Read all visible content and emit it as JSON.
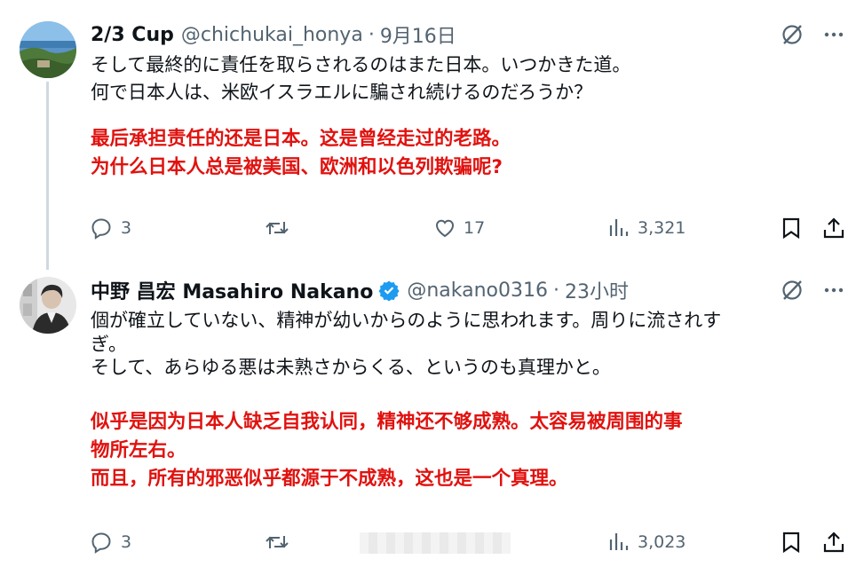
{
  "tweets": [
    {
      "name": "2/3 Cup",
      "handle": "@chichukai_honya",
      "separator": "·",
      "time": "9月16日",
      "verified": false,
      "text_lines": [
        "そして最終的に責任を取らされるのはまた日本。いつかきた道。",
        "何で日本人は、米欧イスラエルに騙され続けるのだろうか？"
      ],
      "translation_lines": [
        "最后承担责任的还是日本。这是曾经走过的老路。",
        "为什么日本人总是被美国、欧洲和以色列欺骗呢?"
      ],
      "replies": "3",
      "retweets": "",
      "likes": "17",
      "views": "3,321"
    },
    {
      "name": "中野 昌宏 Masahiro Nakano",
      "handle": "@nakano0316",
      "separator": "·",
      "time": "23小时",
      "verified": true,
      "text_lines": [
        "個が確立していない、精神が幼いからのように思われます。周りに流されす",
        "ぎ。",
        "そして、あらゆる悪は未熟さからくる、というのも真理かと。"
      ],
      "translation_lines": [
        "似乎是因为日本人缺乏自我认同，精神还不够成熟。太容易被周围的事",
        "物所左右。",
        "而且，所有的邪恶似乎都源于不成熟，这也是一个真理。"
      ],
      "replies": "3",
      "retweets": "",
      "likes": "",
      "views": "3,023"
    }
  ],
  "colors": {
    "text": "#0f1419",
    "secondary": "#536471",
    "translation": "#e0120f",
    "verified": "#1d9bf0",
    "thread_line": "#cfd9de"
  },
  "icons": [
    "grok-icon",
    "more-icon",
    "reply-icon",
    "retweet-icon",
    "like-icon",
    "views-icon",
    "bookmark-icon",
    "share-icon",
    "verified-badge-icon"
  ]
}
